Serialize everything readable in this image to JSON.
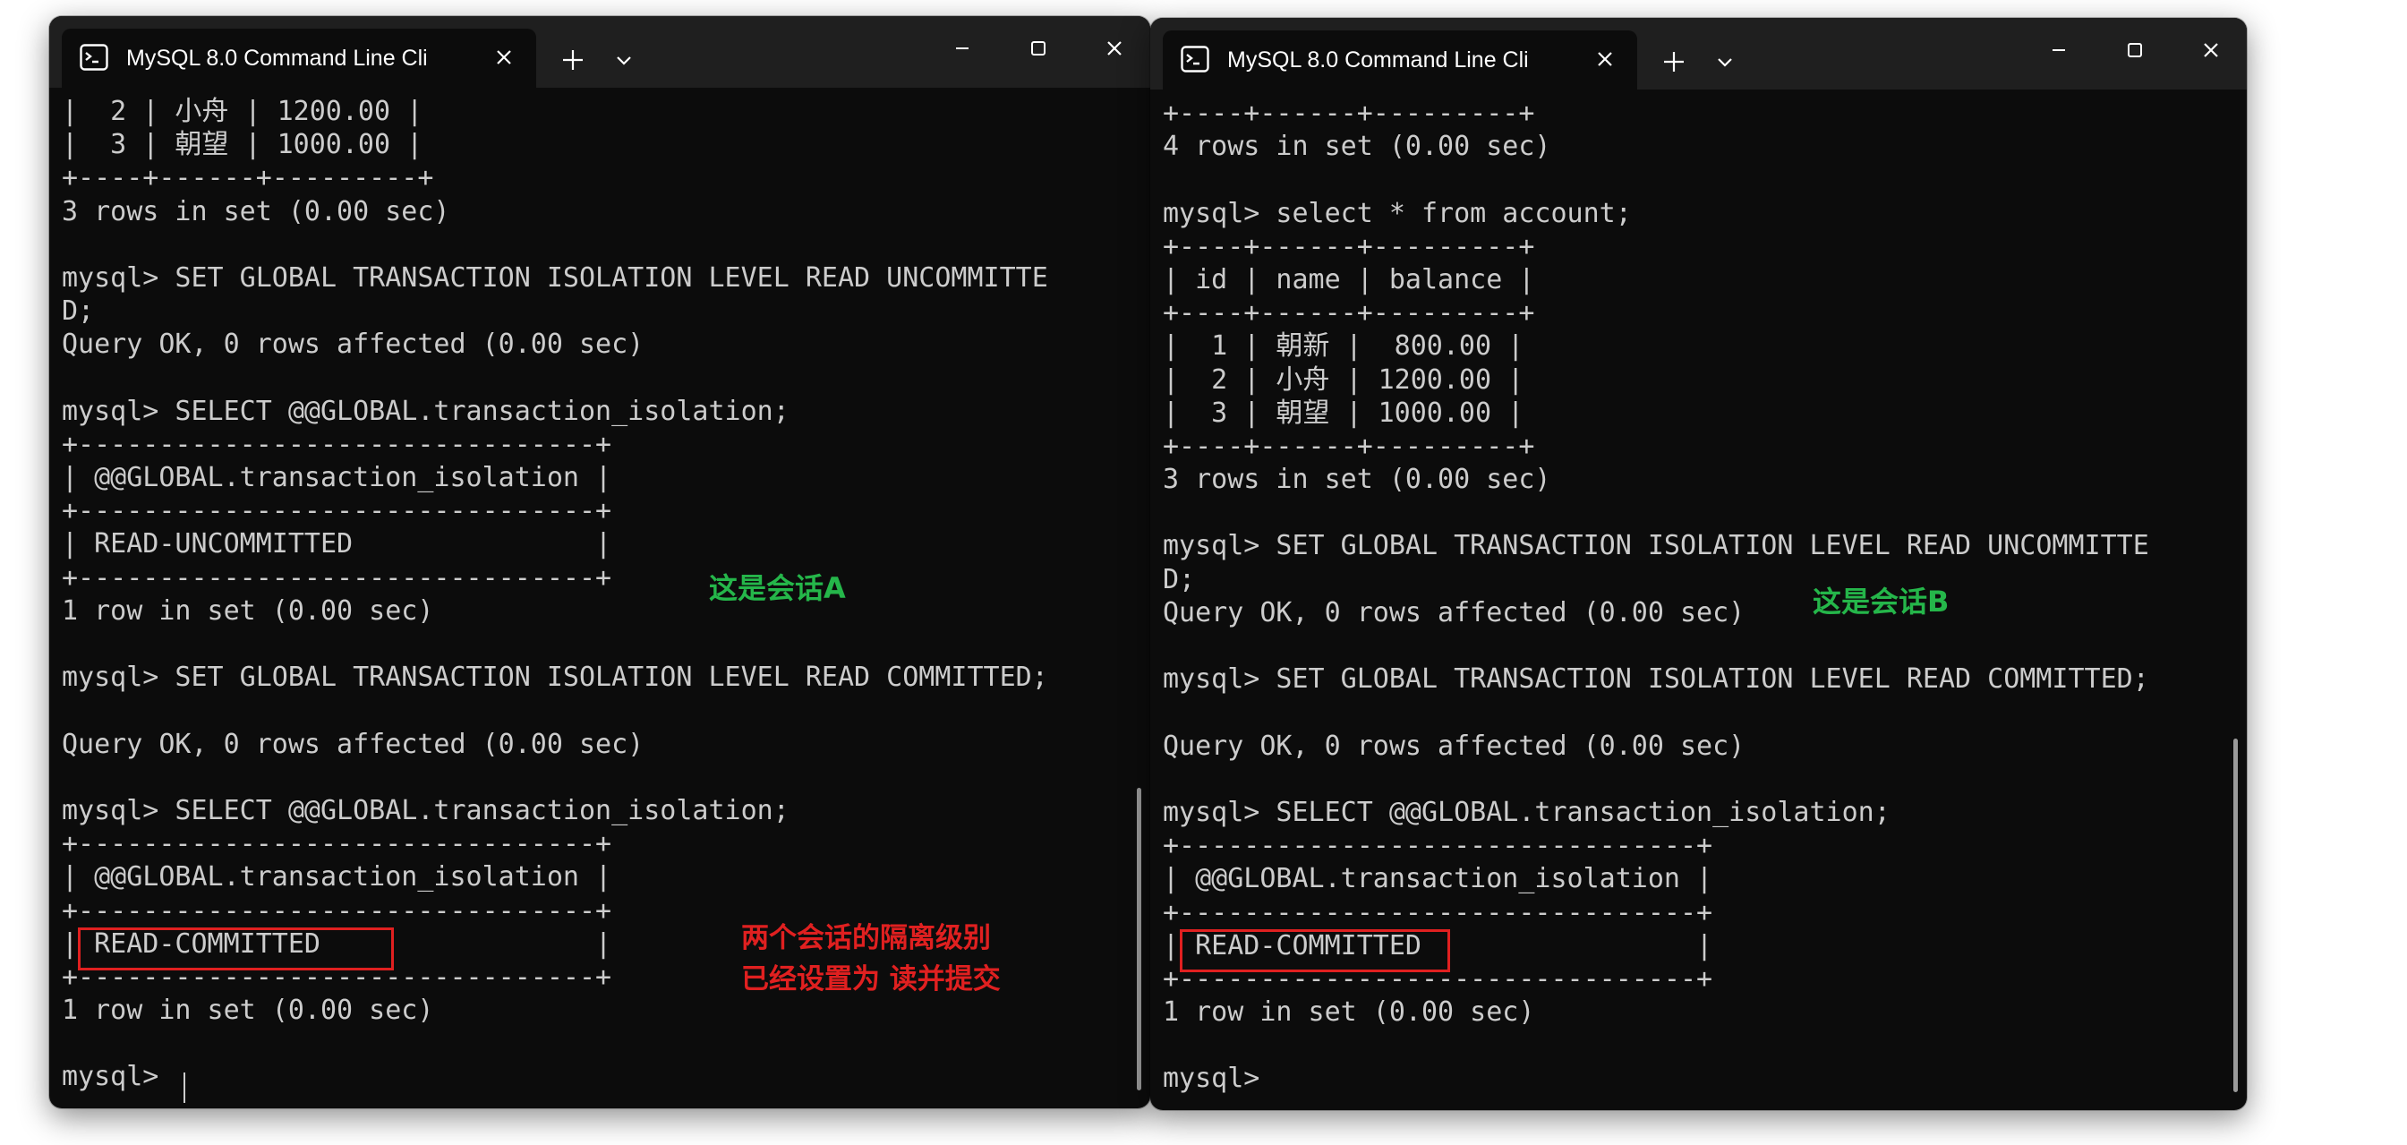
{
  "colors": {
    "terminal_background": "#0c0c0c",
    "terminal_text": "#cccccc",
    "titlebar": "#1f1f1f",
    "annotation_green": "#25b64a",
    "annotation_red": "#e02020"
  },
  "window_a": {
    "tab_title": "MySQL 8.0 Command Line Cli",
    "icons": [
      "terminal-app-icon",
      "close-icon",
      "plus-icon",
      "chevron-down-icon",
      "minimize-icon",
      "maximize-icon",
      "close-icon"
    ],
    "lines": [
      "|  2 | 小舟 | 1200.00 |",
      "|  3 | 朝望 | 1000.00 |",
      "+----+------+---------+",
      "3 rows in set (0.00 sec)",
      "",
      "mysql> SET GLOBAL TRANSACTION ISOLATION LEVEL READ UNCOMMITTE",
      "D;",
      "Query OK, 0 rows affected (0.00 sec)",
      "",
      "mysql> SELECT @@GLOBAL.transaction_isolation;",
      "+--------------------------------+",
      "| @@GLOBAL.transaction_isolation |",
      "+--------------------------------+",
      "| READ-UNCOMMITTED               |",
      "+--------------------------------+",
      "1 row in set (0.00 sec)",
      "",
      "mysql> SET GLOBAL TRANSACTION ISOLATION LEVEL READ COMMITTED;",
      "",
      "Query OK, 0 rows affected (0.00 sec)",
      "",
      "mysql> SELECT @@GLOBAL.transaction_isolation;",
      "+--------------------------------+",
      "| @@GLOBAL.transaction_isolation |",
      "+--------------------------------+",
      "| READ-COMMITTED                 |",
      "+--------------------------------+",
      "1 row in set (0.00 sec)",
      "",
      "mysql> "
    ]
  },
  "window_b": {
    "tab_title": "MySQL 8.0 Command Line Cli",
    "icons": [
      "terminal-app-icon",
      "close-icon",
      "plus-icon",
      "chevron-down-icon",
      "minimize-icon",
      "maximize-icon",
      "close-icon"
    ],
    "lines": [
      "+----+------+---------+",
      "4 rows in set (0.00 sec)",
      "",
      "mysql> select * from account;",
      "+----+------+---------+",
      "| id | name | balance |",
      "+----+------+---------+",
      "|  1 | 朝新 |  800.00 |",
      "|  2 | 小舟 | 1200.00 |",
      "|  3 | 朝望 | 1000.00 |",
      "+----+------+---------+",
      "3 rows in set (0.00 sec)",
      "",
      "mysql> SET GLOBAL TRANSACTION ISOLATION LEVEL READ UNCOMMITTE",
      "D;",
      "Query OK, 0 rows affected (0.00 sec)",
      "",
      "mysql> SET GLOBAL TRANSACTION ISOLATION LEVEL READ COMMITTED;",
      "",
      "Query OK, 0 rows affected (0.00 sec)",
      "",
      "mysql> SELECT @@GLOBAL.transaction_isolation;",
      "+--------------------------------+",
      "| @@GLOBAL.transaction_isolation |",
      "+--------------------------------+",
      "| READ-COMMITTED                 |",
      "+--------------------------------+",
      "1 row in set (0.00 sec)",
      "",
      "mysql> "
    ]
  },
  "annotations": {
    "session_a": "这是会话A",
    "session_b": "这是会话B",
    "note_line1": "两个会话的隔离级别",
    "note_line2": "已经设置为 读并提交"
  }
}
